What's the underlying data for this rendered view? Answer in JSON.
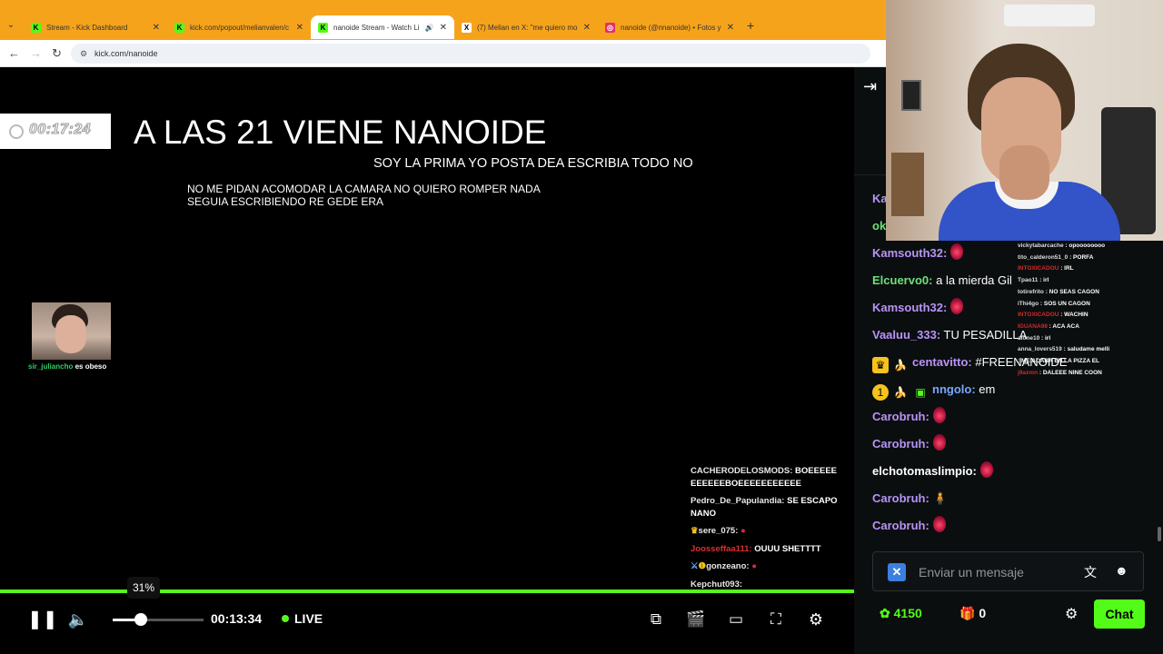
{
  "browser": {
    "tabs": [
      {
        "label": "Stream - Kick Dashboard",
        "favicon_color": "#53fc18",
        "favicon": "K"
      },
      {
        "label": "kick.com/popout/melianvalen/c",
        "favicon_color": "#53fc18",
        "favicon": "K"
      },
      {
        "label": "nanoide Stream - Watch Li",
        "favicon_color": "#53fc18",
        "favicon": "K",
        "active": true
      },
      {
        "label": "(7) Melian en X: \"me quiero mo",
        "favicon_color": "#000000",
        "favicon": "X"
      },
      {
        "label": "nanoide (@nnanoide) • Fotos y",
        "favicon_color": "#e1306c",
        "favicon": "◎"
      }
    ],
    "address": "kick.com/nanoide",
    "accent": "#f6a31c"
  },
  "stream_overlay": {
    "timer": "00:17:24",
    "headline": "A LAS 21 VIENE NANOIDE",
    "subtitle": "SOY LA PRIMA YO POSTA DEA ESCRIBIA TODO NO",
    "note_line1": "NO ME PIDAN ACOMODAR LA CAMARA NO QUIERO ROMPER NADA",
    "note_line2": "SEGUIA ESCRIBIENDO RE GEDE ERA",
    "mini_cam_user": "sir_juliancho",
    "mini_cam_text": " es obeso"
  },
  "ingame_chat": [
    {
      "user": "CACHERODELOSMODS:",
      "text": " BOEEEEE EEEEEEBOEEEEEEEEEEE",
      "red": false
    },
    {
      "user": "Pedro_De_Papulandia:",
      "text": " SE ESCAPO NANO",
      "red": false
    },
    {
      "user": "sere_075:",
      "text": "",
      "red": false
    },
    {
      "user": "Joosseffaa111:",
      "text": " OUUU SHETTTT",
      "red": true
    },
    {
      "user": "gonzeano:",
      "text": "",
      "red": false
    },
    {
      "user": "Kepchut093:",
      "text": "",
      "red": false
    }
  ],
  "webcam_overlay_chat": [
    {
      "user": "vickytabarcache",
      "text": " : opoooooooo",
      "red": false
    },
    {
      "user": "tito_calderon51_0",
      "text": " : PORFA",
      "red": false
    },
    {
      "user": "INTOXICADOU",
      "text": " : IRL",
      "red": true
    },
    {
      "user": "Tpao11",
      "text": " : irl",
      "red": false
    },
    {
      "user": "totirefrito",
      "text": " : NO SEAS CAGON",
      "red": false
    },
    {
      "user": "iThi4go",
      "text": " : SOS UN CAGON",
      "red": false
    },
    {
      "user": "INTOXICADOU",
      "text": " : WACHIN",
      "red": true
    },
    {
      "user": "IGUANA98",
      "text": " : ACA ACA",
      "red": true
    },
    {
      "user": "alone10",
      "text": " : irl",
      "red": false
    },
    {
      "user": "anna_lovers519",
      "text": " : saludame melli",
      "red": false
    },
    {
      "user": "",
      "text": " : ME ACABA EN LA PIZZA EL",
      "red": false
    },
    {
      "user": "j9azmn",
      "text": " : DALEEE NINE COON",
      "red": true
    }
  ],
  "player": {
    "volume_pct": 31,
    "volume_label": "31%",
    "elapsed": "00:13:34",
    "live_label": "LIVE",
    "progress_color": "#53fc18"
  },
  "chat": {
    "messages": [
      {
        "user": "Ka",
        "color": "#b794f6",
        "text": "",
        "emote": false
      },
      {
        "user": "ok",
        "color": "#6ee07a",
        "text": "",
        "emote": false
      },
      {
        "user": "Kamsouth32:",
        "color": "#b794f6",
        "text": "",
        "emote": true
      },
      {
        "user": "Elcuervo0:",
        "color": "#6ee07a",
        "text": " a la mierda Gil",
        "emote": false
      },
      {
        "user": "Kamsouth32:",
        "color": "#b794f6",
        "text": "",
        "emote": true
      },
      {
        "user": "Vaaluu_333:",
        "color": "#b794f6",
        "text": " TU PESADILLA",
        "emote": false
      },
      {
        "user": "centavitto:",
        "color": "#b794f6",
        "text": " #FREENANOIDE",
        "emote": false,
        "badges": [
          "👑",
          "🍌"
        ]
      },
      {
        "user": "nngolo:",
        "color": "#7aa7ff",
        "text": " em",
        "emote": false,
        "badges": [
          "1",
          "🍌",
          "▣"
        ]
      },
      {
        "user": "Carobruh:",
        "color": "#b794f6",
        "text": "",
        "emote": true
      },
      {
        "user": "Carobruh:",
        "color": "#b794f6",
        "text": "",
        "emote": true
      },
      {
        "user": "elchotomaslimpio:",
        "color": "#ffffff",
        "text": "",
        "emote": true
      },
      {
        "user": "Carobruh:",
        "color": "#b794f6",
        "text": " 🧍",
        "emote": false
      },
      {
        "user": "Carobruh:",
        "color": "#b794f6",
        "text": "",
        "emote": true
      }
    ],
    "input_placeholder": "Enviar un mensaje",
    "points": "4150",
    "gifts": "0",
    "chat_button": "Chat",
    "accent": "#53fc18"
  }
}
